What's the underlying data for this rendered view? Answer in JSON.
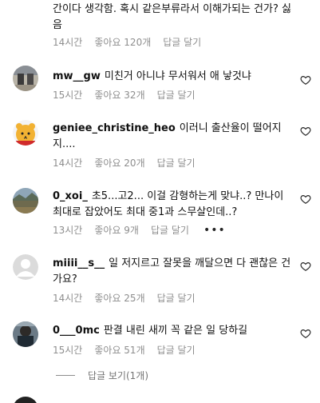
{
  "top_comment": {
    "text": "간이다 생각함. 혹시 같은부류라서 이해가되는 건가? 싫음",
    "time": "14시간",
    "likes": "좋아요 120개",
    "reply": "답글 달기"
  },
  "comments": [
    {
      "username": "mw__gw",
      "text": "미친거 아니냐 무서워서 애 낳것냐",
      "time": "15시간",
      "likes": "좋아요 32개",
      "reply": "답글 달기"
    },
    {
      "username": "geniee_christine_heo",
      "text": "이러니 출산율이 떨어지지....",
      "time": "14시간",
      "likes": "좋아요 20개",
      "reply": "답글 달기"
    },
    {
      "username": "0_xoi_",
      "text": "초5...고2... 이걸 감형하는게 맞냐..? 만나이 최대로 잡았어도 최대 중1과 스무살인데..?",
      "time": "13시간",
      "likes": "좋아요 9개",
      "reply": "답글 달기",
      "more": "•••"
    },
    {
      "username": "miiii__s__",
      "text": "일 저지르고 잘못을 깨달으면 다 괜찮은 건가요?",
      "time": "14시간",
      "likes": "좋아요 25개",
      "reply": "답글 달기"
    },
    {
      "username": "0___0mc",
      "text": "판결 내린 새끼 꼭 같은 일 당하길",
      "time": "15시간",
      "likes": "좋아요 51개",
      "reply": "답글 달기"
    }
  ],
  "view_replies": "답글 보기(1개)",
  "colors": {
    "meta_text": "#8e8e8e",
    "text": "#111111"
  }
}
